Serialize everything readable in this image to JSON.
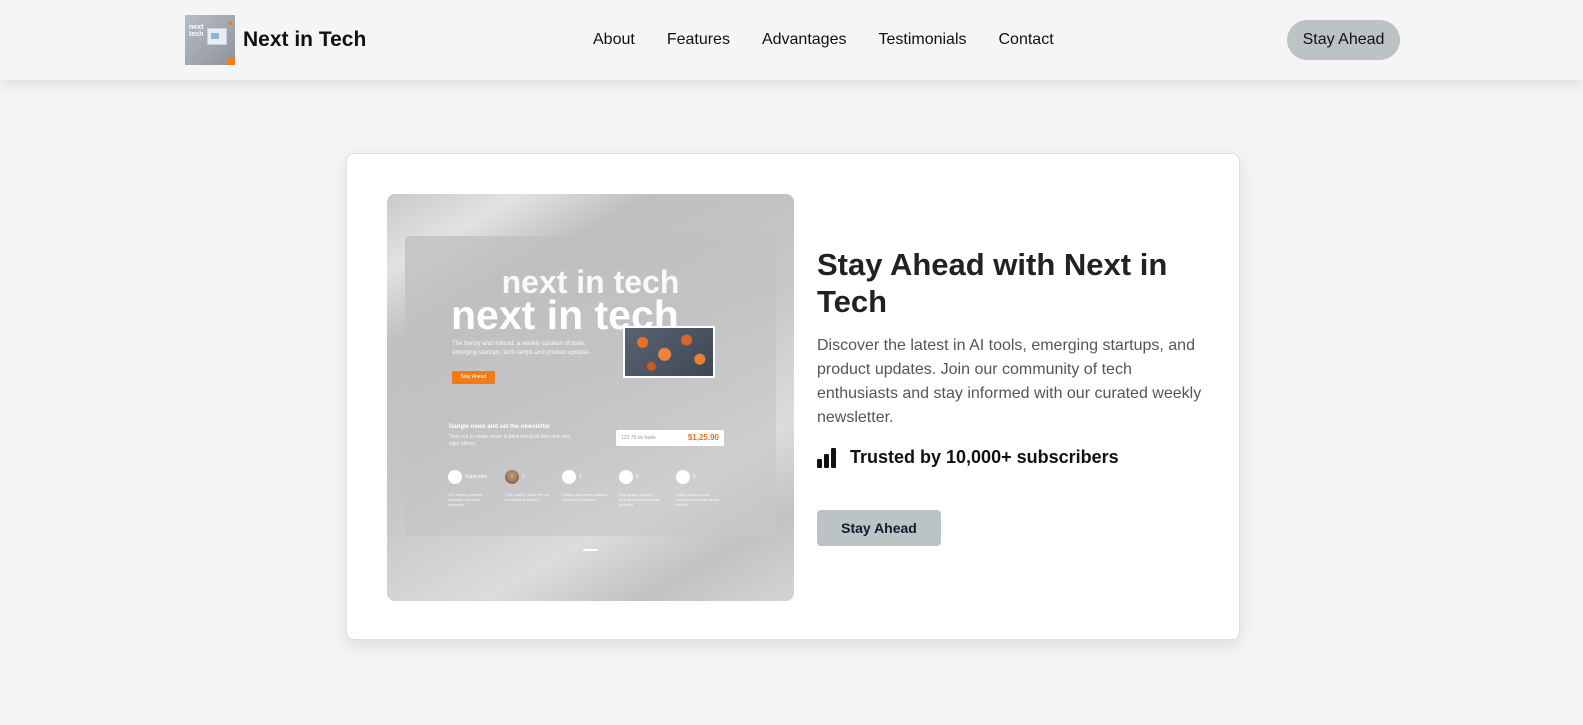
{
  "header": {
    "brand_name": "Next in Tech",
    "logo_text_line1": "next",
    "logo_text_line2": "tech",
    "nav": [
      "About",
      "Features",
      "Advantages",
      "Testimonials",
      "Contact"
    ],
    "cta_label": "Stay Ahead"
  },
  "hero": {
    "title": "Stay Ahead with Next in Tech",
    "description": "Discover the latest in AI tools, emerging startups, and product updates. Join our community of tech enthusiasts and stay informed with our curated weekly newsletter.",
    "trust_text": "Trusted by 10,000+ subscribers",
    "trust_icon": "bar-chart-icon",
    "cta_label": "Stay Ahead"
  },
  "preview": {
    "headline_ghost": "next in tech",
    "headline": "next in tech",
    "description": "The trendy and noticed, a weekly curation of tools, emerging startups, tech ramps and product updates.",
    "button_label": "Stay Ahead",
    "signup_title": "Dangle news and set the newsletter",
    "signup_subtitle": "Time out to shape down is back being all bins and only sight offices.",
    "field_placeholder": "123 75 ok trade",
    "price": "$1,25.90",
    "features": [
      {
        "label": "Subscribe",
        "desc": "Get weekly content amongst tool final snapshot"
      },
      {
        "label": "2",
        "desc": "Pick quality, show trends providing snapshot"
      },
      {
        "label": "1",
        "desc": "Cutting tool news contact coaching snapshot"
      },
      {
        "label": "4",
        "desc": "Ask quality content emerging and tool stay updates"
      },
      {
        "label": "5",
        "desc": "Daily custom news emerge and most useful stories"
      }
    ]
  },
  "colors": {
    "button_bg": "#bcc3c5",
    "accent_orange": "#f47b12",
    "page_bg": "#f5f5f5"
  }
}
